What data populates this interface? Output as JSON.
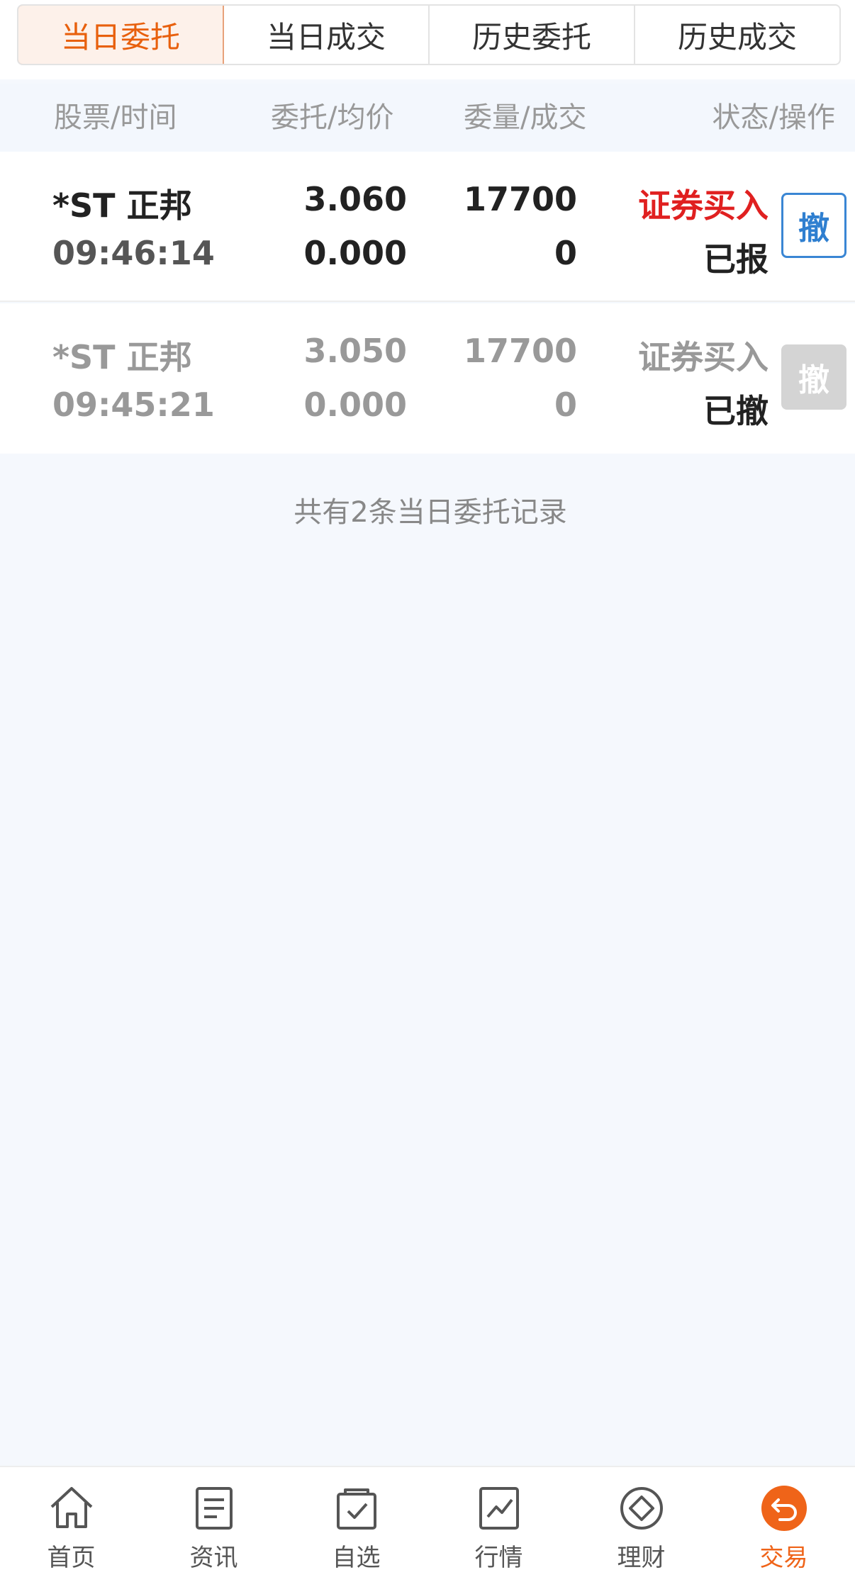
{
  "tabs": [
    {
      "label": "当日委托",
      "active": true
    },
    {
      "label": "当日成交",
      "active": false
    },
    {
      "label": "历史委托",
      "active": false
    },
    {
      "label": "历史成交",
      "active": false
    }
  ],
  "columns": {
    "stock_time": "股票/时间",
    "order_avg": "委托/均价",
    "qty_filled": "委量/成交",
    "status_action": "状态/操作"
  },
  "orders": [
    {
      "stock": "*ST 正邦",
      "time": "09:46:14",
      "order_price": "3.060",
      "avg_price": "0.000",
      "order_qty": "17700",
      "filled_qty": "0",
      "side": "证券买入",
      "status": "已报",
      "cancel_label": "撤",
      "cancel_enabled": true
    },
    {
      "stock": "*ST 正邦",
      "time": "09:45:21",
      "order_price": "3.050",
      "avg_price": "0.000",
      "order_qty": "17700",
      "filled_qty": "0",
      "side": "证券买入",
      "status": "已撤",
      "cancel_label": "撤",
      "cancel_enabled": false
    }
  ],
  "summary": "共有2条当日委托记录",
  "nav": [
    {
      "label": "首页",
      "icon": "home-icon",
      "active": false
    },
    {
      "label": "资讯",
      "icon": "news-icon",
      "active": false
    },
    {
      "label": "自选",
      "icon": "watchlist-icon",
      "active": false
    },
    {
      "label": "行情",
      "icon": "market-chart-icon",
      "active": false
    },
    {
      "label": "理财",
      "icon": "wealth-icon",
      "active": false
    },
    {
      "label": "交易",
      "icon": "trade-icon",
      "active": true
    }
  ],
  "colors": {
    "accent": "#ef6419",
    "buy_red": "#e02020",
    "cancel_blue": "#2f7fd0",
    "disabled_gray": "#d4d4d4"
  }
}
